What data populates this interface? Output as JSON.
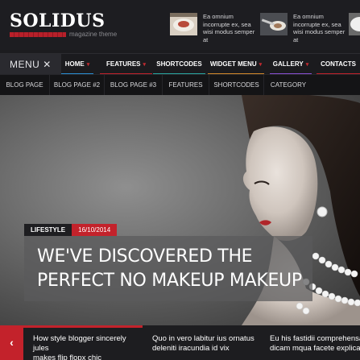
{
  "brand": {
    "name": "SOLIDUS",
    "tagline": "magazine theme",
    "accent_color": "#c3222b"
  },
  "header_posts": [
    {
      "text": "Ea omnium incorrupte ex, sea wisi modus semper at",
      "thumb": "food-plate-thumbnail"
    },
    {
      "text": "Ea omnium incorrupte ex, sea wisi modus semper at",
      "thumb": "spoon-thumbnail"
    },
    {
      "text": "Ea",
      "thumb": "plate-thumbnail"
    }
  ],
  "main_menu": {
    "toggle_label": "MENU",
    "toggle_icon": "close-icon",
    "items": [
      {
        "label": "HOME",
        "has_dropdown": true,
        "underline": "#2a8fd4"
      },
      {
        "label": "FEATURES",
        "has_dropdown": true,
        "underline": "#c3222b"
      },
      {
        "label": "SHORTCODES",
        "has_dropdown": false,
        "underline": "#2aa7a0"
      },
      {
        "label": "WIDGET MENU",
        "has_dropdown": true,
        "underline": "#d48a2a"
      },
      {
        "label": "GALLERY",
        "has_dropdown": true,
        "underline": "#8a4fd4"
      },
      {
        "label": "CONTACTS",
        "has_dropdown": false,
        "underline": "#c3222b"
      }
    ]
  },
  "sub_menu": {
    "items": [
      "BLOG PAGE",
      "BLOG PAGE #2",
      "BLOG PAGE #3",
      "FEATURES",
      "SHORTCODES",
      "CATEGORY"
    ]
  },
  "hero": {
    "category": "LIFESTYLE",
    "date": "16/10/2014",
    "title_line1": "WE'VE DISCOVERED THE",
    "title_line2": "PERFECT NO MAKEUP MAKEUP"
  },
  "ticker": {
    "prev_icon": "chevron-left-icon",
    "items": [
      {
        "line1": "How style blogger sincerely jules",
        "line2": "makes flip flopx chic",
        "active": true
      },
      {
        "line1": "Quo in vero labitur ius ornatus",
        "line2": "deleniti iracundia id vix",
        "active": false
      },
      {
        "line1": "Eu his fastidii comprehensam in",
        "line2": "dicam mqua facete explicari",
        "active": false
      }
    ]
  }
}
